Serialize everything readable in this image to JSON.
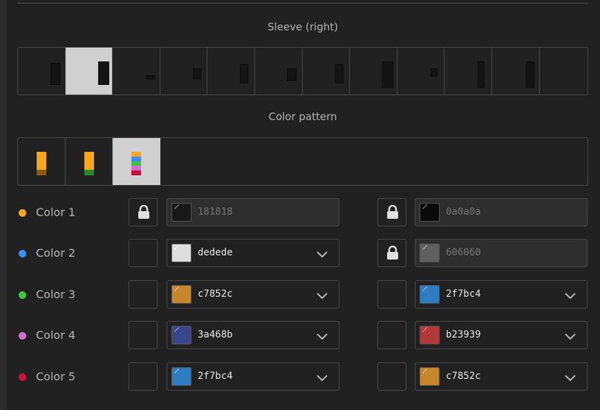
{
  "sleeve": {
    "title": "Sleeve (right)",
    "options": 12,
    "selected_index": 1
  },
  "pattern": {
    "title": "Color pattern",
    "options": 3,
    "selected_index": 2
  },
  "colors": [
    {
      "label": "Color 1",
      "dot": "#f5a623",
      "left": {
        "locked": true,
        "value": "181818"
      },
      "right": {
        "locked": true,
        "value": "0a0a0a"
      }
    },
    {
      "label": "Color 2",
      "dot": "#3b8ef5",
      "left": {
        "locked": false,
        "value": "dedede"
      },
      "right": {
        "locked": true,
        "value": "606060"
      }
    },
    {
      "label": "Color 3",
      "dot": "#3fc43f",
      "left": {
        "locked": false,
        "value": "c7852c"
      },
      "right": {
        "locked": false,
        "value": "2f7bc4"
      }
    },
    {
      "label": "Color 4",
      "dot": "#d36fd3",
      "left": {
        "locked": false,
        "value": "3a468b"
      },
      "right": {
        "locked": false,
        "value": "b23939"
      }
    },
    {
      "label": "Color 5",
      "dot": "#d0103a",
      "left": {
        "locked": false,
        "value": "2f7bc4"
      },
      "right": {
        "locked": false,
        "value": "c7852c"
      }
    }
  ]
}
